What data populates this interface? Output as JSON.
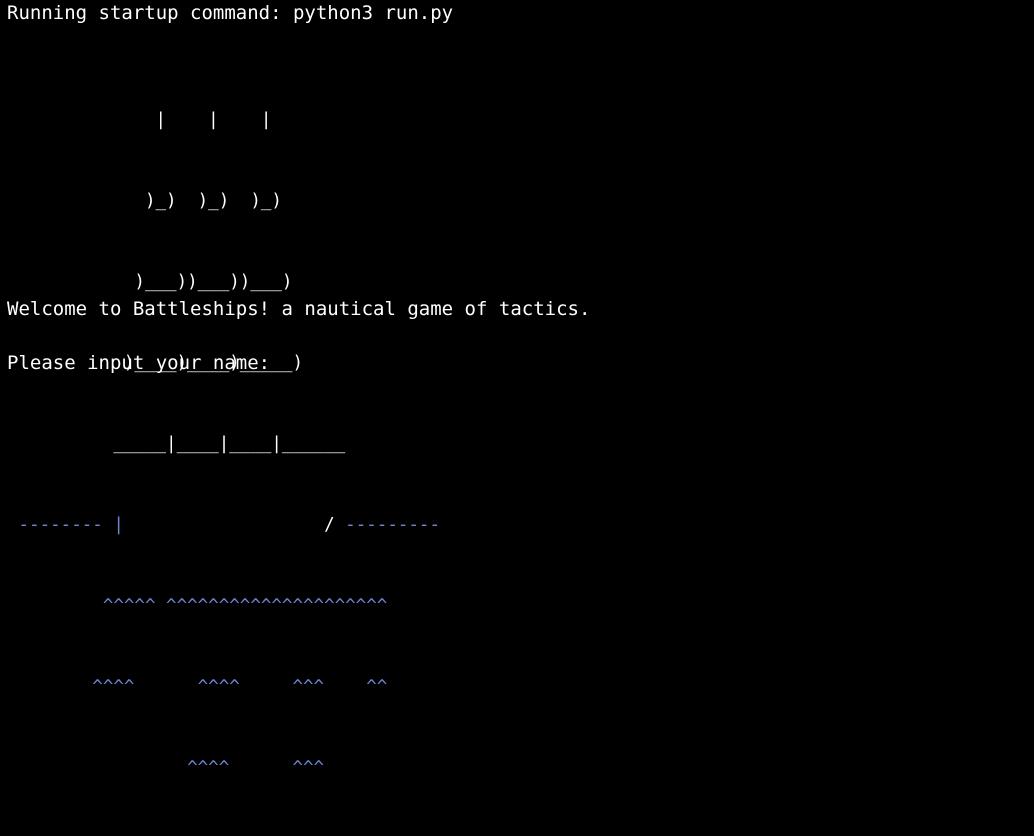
{
  "terminal": {
    "startup_line": "Running startup command: python3 run.py",
    "ship_art": {
      "row1": "              |    |    |",
      "row2": "             )_)  )_)  )_)",
      "row3": "            )___))___))___)",
      "row4": "           )____)____)_____)",
      "row5_ship": "_____|____|____|______",
      "row6_waves_left": " -------- |",
      "row6_hull": "                   / ",
      "row6_waves_right": "---------",
      "row7": "         ^^^^^ ^^^^^^^^^^^^^^^^^^^^^",
      "row8": "        ^^^^      ^^^^     ^^^    ^^",
      "row9": "                 ^^^^      ^^^"
    },
    "welcome_line": "Welcome to Battleships! a nautical game of tactics.",
    "prompt_line": "Please input your name: ",
    "colors": {
      "background": "#000000",
      "text": "#ffffff",
      "accent": "#6f86d6"
    }
  }
}
